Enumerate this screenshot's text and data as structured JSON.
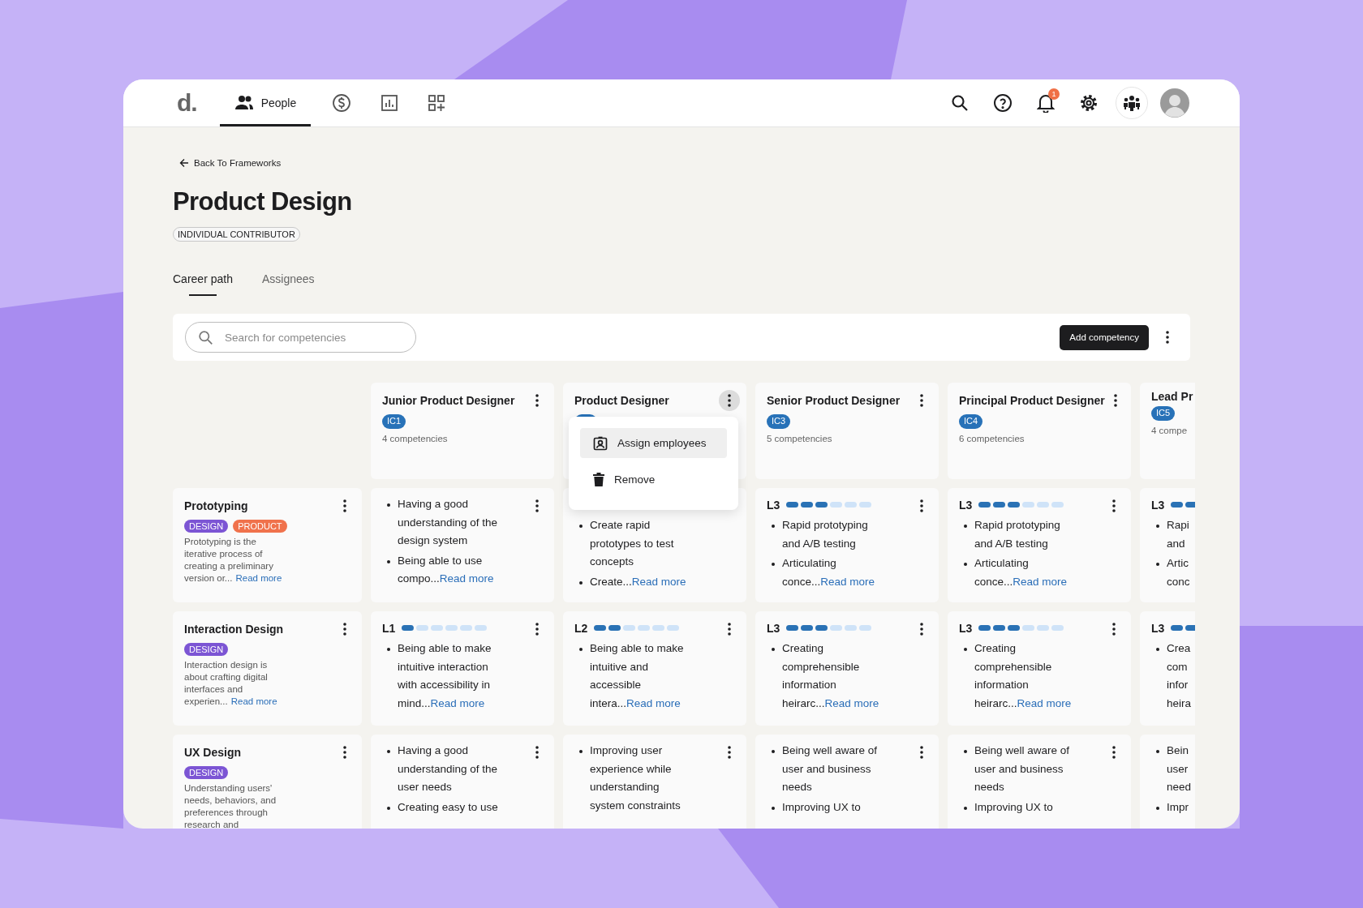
{
  "nav": {
    "logo": "d.",
    "tabs": [
      {
        "kind": "people",
        "label": "People",
        "selected": true
      },
      {
        "kind": "coin",
        "selected": false
      },
      {
        "kind": "chart",
        "selected": false
      },
      {
        "kind": "apps",
        "selected": false
      }
    ],
    "actions": [
      {
        "kind": "search"
      },
      {
        "kind": "help"
      },
      {
        "kind": "bell",
        "badge": "1"
      },
      {
        "kind": "settings"
      },
      {
        "kind": "team"
      },
      {
        "kind": "avatar"
      }
    ]
  },
  "back_link": "Back To Frameworks",
  "title": "Product Design",
  "category": "INDIVIDUAL CONTRIBUTOR",
  "tabs": [
    {
      "label": "Career path",
      "selected": true
    },
    {
      "label": "Assignees",
      "selected": false
    }
  ],
  "toolbar": {
    "search": {
      "placeholder": "Search for competencies"
    },
    "button": "Add competency"
  },
  "columns": [
    {
      "title": "Junior Product Designer",
      "badge": "IC1",
      "count": "4 competencies",
      "menu_open": false
    },
    {
      "title": "Product Designer",
      "menu_open": true
    },
    {
      "title": "Senior Product Designer",
      "badge": "IC3",
      "count": "5 competencies",
      "menu_open": false
    },
    {
      "title": "Principal Product Designer",
      "badge": "IC4",
      "count": "6 competencies",
      "menu_open": false
    },
    {
      "title": "Lead Pr",
      "badge": "IC5",
      "count": "4 compe",
      "menu_open": false
    }
  ],
  "column_menu": {
    "items": [
      {
        "kind": "assign",
        "label": "Assign employees",
        "selected": true
      },
      {
        "kind": "remove",
        "label": "Remove",
        "selected": false
      }
    ]
  },
  "rows": [
    {
      "competency": {
        "name": "Prototyping",
        "tags": [
          {
            "label": "DESIGN",
            "color": "#7c55d4"
          },
          {
            "label": "PRODUCT",
            "color": "#f0724c"
          }
        ],
        "description": "Prototyping is the iterative process of creating a preliminary version or...",
        "link": "Read more"
      },
      "cells": [
        {
          "kind": "plain",
          "bullets": [
            "Having a good understanding of the design system",
            "Being able to use compo..."
          ],
          "link": "Read more"
        },
        {
          "kind": "leveled",
          "bullets": [
            "Create rapid prototypes to test concepts",
            "Create..."
          ],
          "link": "Read more"
        },
        {
          "kind": "leveled",
          "level_label": "L3",
          "level": 0.5,
          "bullets": [
            "Rapid prototyping and A/B testing",
            "Articulating conce..."
          ],
          "link": "Read more"
        },
        {
          "kind": "leveled",
          "level_label": "L3",
          "level": 0.5,
          "bullets": [
            "Rapid prototyping and A/B testing",
            "Articulating conce..."
          ],
          "link": "Read more"
        },
        {
          "kind": "leveled",
          "level_label": "L3",
          "level": 0.5,
          "bullets": [
            "Rapi\nand",
            "Artic\nconc"
          ]
        }
      ]
    },
    {
      "competency": {
        "name": "Interaction Design",
        "tags": [
          {
            "label": "DESIGN",
            "color": "#7c55d4"
          }
        ],
        "description": "Interaction design is about crafting digital interfaces and experien...",
        "link": "Read more"
      },
      "cells": [
        {
          "kind": "leveled",
          "level_label": "L1",
          "level": 0.1667,
          "bullets": [
            "Being able to make intuitive interaction with accessibility in mind..."
          ],
          "link": "Read more"
        },
        {
          "kind": "leveled",
          "level_label": "L2",
          "level": 0.3333,
          "bullets": [
            "Being able to make intuitive and accessible intera..."
          ],
          "link": "Read more"
        },
        {
          "kind": "leveled",
          "level_label": "L3",
          "level": 0.5,
          "bullets": [
            "Creating comprehensible information heirarc..."
          ],
          "link": "Read more"
        },
        {
          "kind": "leveled",
          "level_label": "L3",
          "level": 0.5,
          "bullets": [
            "Creating comprehensible information heirarc..."
          ],
          "link": "Read more"
        },
        {
          "kind": "leveled",
          "level_label": "L3",
          "level": 0.5,
          "bullets": [
            "Crea\ncom\ninfor\nheira"
          ]
        }
      ]
    },
    {
      "competency": {
        "name": "UX Design",
        "tags": [
          {
            "label": "DESIGN",
            "color": "#7c55d4"
          }
        ],
        "description": "Understanding users' needs, behaviors, and preferences through research and"
      },
      "cells": [
        {
          "kind": "plain",
          "bullets": [
            "Having a good understanding of the user needs",
            "Creating easy to use"
          ]
        },
        {
          "kind": "plain",
          "bullets": [
            "Improving user experience while understanding system constraints"
          ]
        },
        {
          "kind": "plain",
          "bullets": [
            "Being well aware of user and business needs",
            "Improving UX to"
          ]
        },
        {
          "kind": "plain",
          "bullets": [
            "Being well aware of user and business needs",
            "Improving UX to"
          ]
        },
        {
          "kind": "plain",
          "bullets": [
            "Bein\nuser\nneed",
            "Impr"
          ]
        }
      ]
    }
  ]
}
